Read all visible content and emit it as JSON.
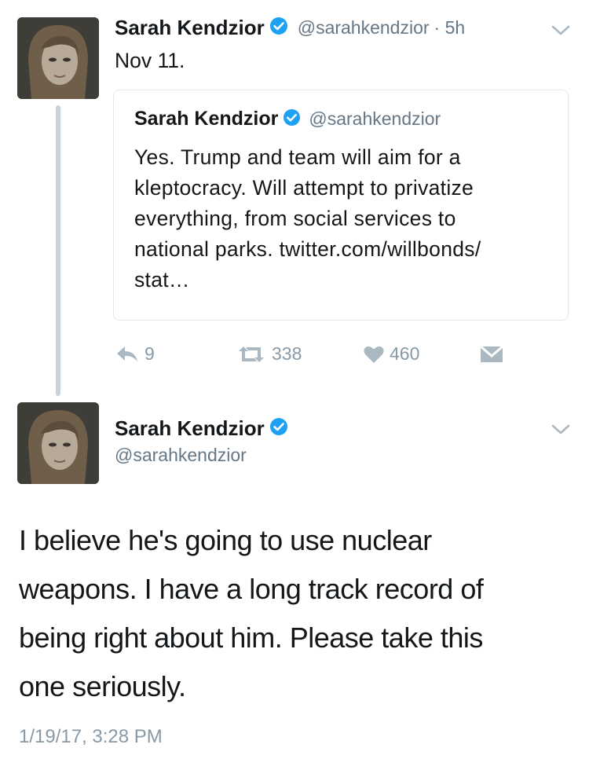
{
  "colors": {
    "verified": "#1da1f2",
    "secondary": "#8899a6",
    "thread_line": "#c9d2d9"
  },
  "previous_tweet": {
    "author_name": "Sarah Kendzior",
    "author_handle": "@sarahkendzior",
    "age": "· 5h",
    "text": "Nov 11.",
    "quoted_tweet": {
      "author_name": "Sarah Kendzior",
      "author_handle": "@sarahkendzior",
      "lines": [
        "Yes. Trump and team will aim for a",
        "kleptocracy. Will attempt to privatize",
        "everything, from social services to",
        "national parks. twitter.com/willbonds/",
        "stat…"
      ]
    },
    "actions": {
      "reply_count": "9",
      "retweet_count": "338",
      "like_count": "460"
    }
  },
  "main_tweet": {
    "author_name": "Sarah Kendzior",
    "author_handle": "@sarahkendzior",
    "lines": [
      "I believe he's going to use nuclear",
      "weapons. I have a long track record of",
      "being right about him. Please take this",
      "one seriously."
    ],
    "timestamp": "1/19/17, 3:28 PM"
  },
  "icons": {
    "verified": "verified-badge-icon",
    "chevron": "chevron-down-icon",
    "reply": "reply-icon",
    "retweet": "retweet-icon",
    "like": "heart-icon",
    "dm": "direct-message-icon"
  }
}
